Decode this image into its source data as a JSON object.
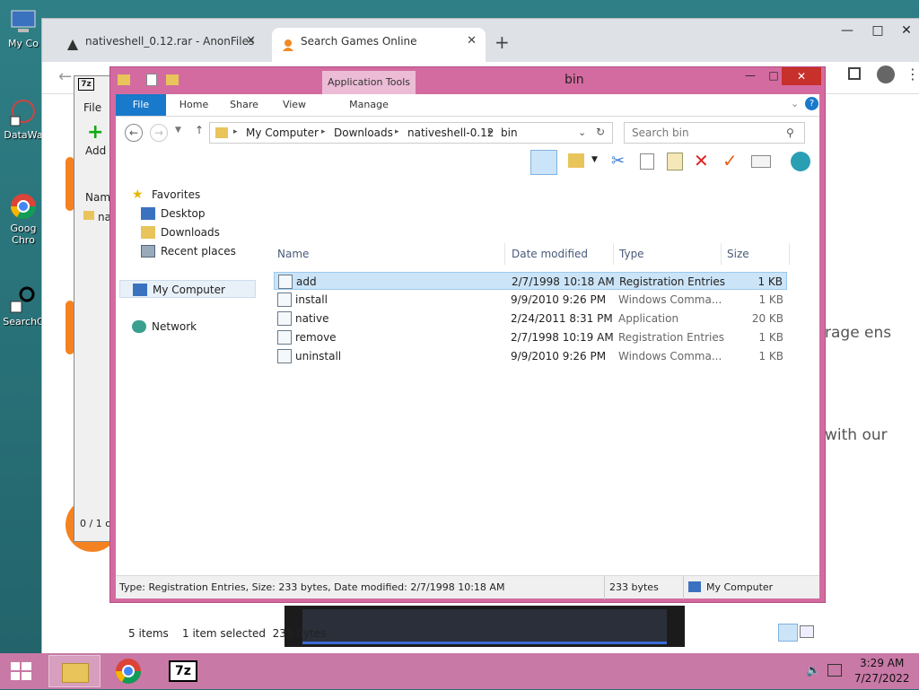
{
  "desktop": {
    "icons": [
      {
        "label": "My Co",
        "icon": "computer-icon"
      },
      {
        "label": "DataWa",
        "icon": "app-shortcut-icon"
      },
      {
        "label": "Goog",
        "label2": "Chro",
        "icon": "chrome-icon"
      },
      {
        "label": "SearchC",
        "icon": "app-shortcut-icon"
      }
    ]
  },
  "chrome": {
    "tabs": [
      {
        "title": "nativeshell_0.12.rar - AnonFiles",
        "icon": "anonfiles-icon"
      },
      {
        "title": "Search Games Online",
        "icon": "search-games-icon"
      }
    ],
    "close_symbol": "✕",
    "newtab_symbol": "+",
    "page_text": [
      "rage ens",
      "with our"
    ]
  },
  "sevenzip": {
    "menu_file": "File",
    "add_label": "Add",
    "col_name": "Name",
    "row": "na",
    "status": "0 / 1 o"
  },
  "explorer": {
    "title": "bin",
    "context_tab": "Application Tools",
    "ribbon": {
      "file": "File",
      "home": "Home",
      "share": "Share",
      "view": "View",
      "manage": "Manage"
    },
    "breadcrumb": [
      "My Computer",
      "Downloads",
      "nativeshell-0.12",
      "bin"
    ],
    "search_placeholder": "Search bin",
    "nav": {
      "favorites": "Favorites",
      "desktop": "Desktop",
      "downloads": "Downloads",
      "recent": "Recent places",
      "computer": "My Computer",
      "network": "Network"
    },
    "columns": {
      "name": "Name",
      "date": "Date modified",
      "type": "Type",
      "size": "Size"
    },
    "files": [
      {
        "name": "add",
        "date": "2/7/1998 10:18 AM",
        "type": "Registration Entries",
        "size": "1 KB"
      },
      {
        "name": "install",
        "date": "9/9/2010 9:26 PM",
        "type": "Windows Comma...",
        "size": "1 KB"
      },
      {
        "name": "native",
        "date": "2/24/2011 8:31 PM",
        "type": "Application",
        "size": "20 KB"
      },
      {
        "name": "remove",
        "date": "2/7/1998 10:19 AM",
        "type": "Registration Entries",
        "size": "1 KB"
      },
      {
        "name": "uninstall",
        "date": "9/9/2010 9:26 PM",
        "type": "Windows Comma...",
        "size": "1 KB"
      }
    ],
    "item_count": "5 items",
    "selection": "1 item selected  233 bytes",
    "status_detail": "Type: Registration Entries, Size: 233 bytes, Date modified: 2/7/1998 10:18 AM",
    "status_size": "233 bytes",
    "status_location": "My Computer"
  },
  "taskbar": {
    "time": "3:29 AM",
    "date": "7/27/2022",
    "sevenz_label": "7z"
  },
  "colors": {
    "accent": "#d46ba0",
    "selection": "#cce4f7",
    "ribbon_file": "#1979ca"
  }
}
